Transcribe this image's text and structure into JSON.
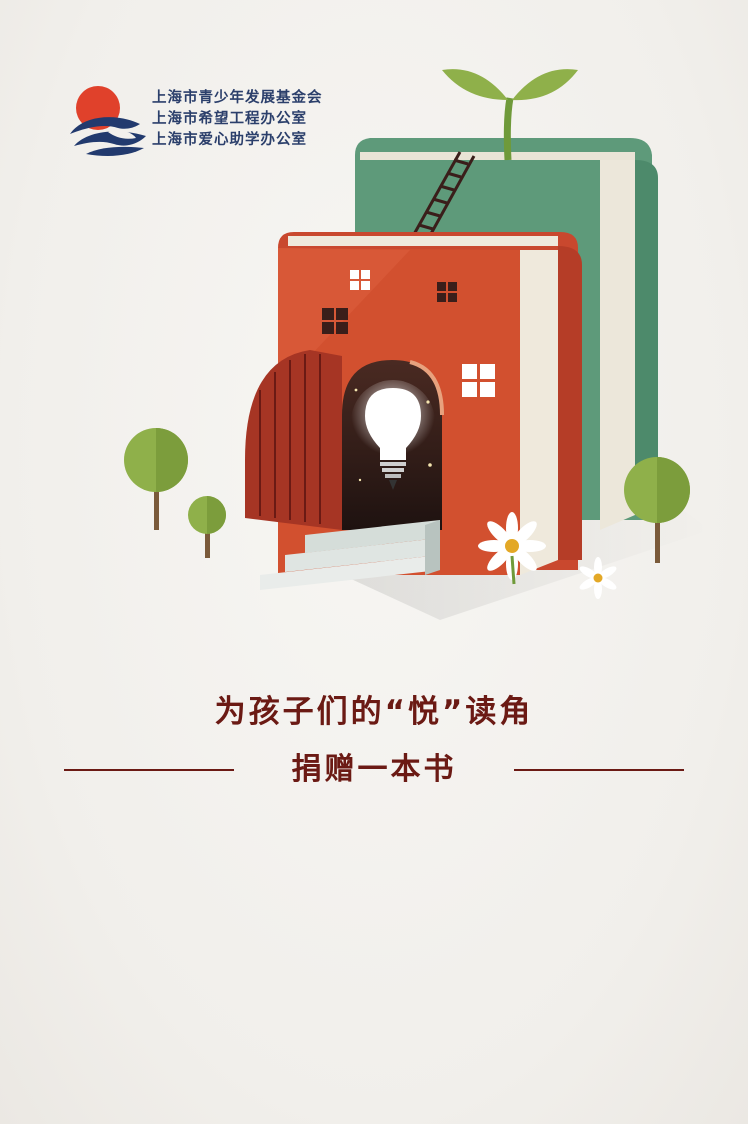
{
  "organizations": [
    "上海市青少年发展基金会",
    "上海市希望工程办公室",
    "上海市爱心助学办公室"
  ],
  "headline": "为孩子们的“悦”读角",
  "subline": "捐赠一本书",
  "colors": {
    "background": "#f2f0ed",
    "headline_text": "#6b1a14",
    "org_text": "#2b3f6b",
    "logo_red": "#e0412b",
    "logo_navy": "#223a6e",
    "book_red": "#c9482e",
    "book_green": "#5e9a7a",
    "leaf_green": "#8fb04a"
  },
  "icons": {
    "logo": "sun-wave-logo-icon",
    "illustration": "book-house-illustration",
    "bulb": "light-bulb-icon"
  }
}
